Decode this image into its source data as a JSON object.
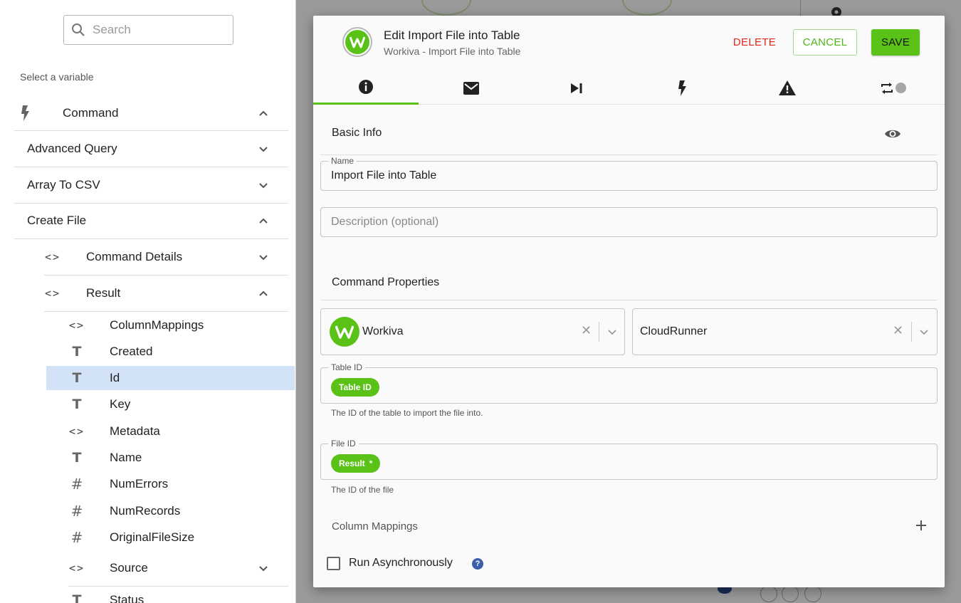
{
  "left_panel": {
    "search_placeholder": "Search",
    "select_label": "Select a variable",
    "items": [
      {
        "label": "Command",
        "icon": "lightning-icon",
        "expanded": true
      },
      {
        "label": "Advanced Query",
        "expanded": false
      },
      {
        "label": "Array To CSV",
        "expanded": false
      },
      {
        "label": "Create File",
        "expanded": true
      },
      {
        "label": "Command Details",
        "icon": "code-icon",
        "expanded": false
      },
      {
        "label": "Result",
        "icon": "code-icon",
        "expanded": true
      },
      {
        "label": "ColumnMappings",
        "icon": "code-icon"
      },
      {
        "label": "Created",
        "icon": "text-type-icon"
      },
      {
        "label": "Id",
        "icon": "text-type-icon",
        "selected": true
      },
      {
        "label": "Key",
        "icon": "text-type-icon"
      },
      {
        "label": "Metadata",
        "icon": "code-icon"
      },
      {
        "label": "Name",
        "icon": "text-type-icon"
      },
      {
        "label": "NumErrors",
        "icon": "number-type-icon"
      },
      {
        "label": "NumRecords",
        "icon": "number-type-icon"
      },
      {
        "label": "OriginalFileSize",
        "icon": "number-type-icon"
      },
      {
        "label": "Source",
        "icon": "code-icon",
        "expanded": false
      },
      {
        "label": "Status",
        "icon": "text-type-icon"
      }
    ]
  },
  "modal": {
    "title": "Edit Import File into Table",
    "subtitle": "Workiva - Import File into Table",
    "delete_label": "DELETE",
    "cancel_label": "CANCEL",
    "save_label": "SAVE",
    "tabs": [
      "info-icon",
      "mail-icon",
      "skip-next-icon",
      "lightning-icon",
      "warning-icon",
      "repeat-toggle-icon"
    ],
    "basic_info_heading": "Basic Info",
    "name_label": "Name",
    "name_value": "Import File into Table",
    "description_placeholder": "Description (optional)",
    "command_properties_heading": "Command Properties",
    "connector_value": "Workiva",
    "runner_value": "CloudRunner",
    "table_id_label": "Table ID",
    "table_id_chip": "Table ID",
    "table_id_help": "The ID of the table to import the file into.",
    "file_id_label": "File ID",
    "file_id_chip": "Result",
    "file_id_help": "The ID of the file",
    "column_mappings_label": "Column Mappings",
    "run_async_label": "Run Asynchronously",
    "help_symbol": "?"
  },
  "colors": {
    "accent_green": "#5ac216",
    "delete_red": "#e0261c",
    "selected_row": "#d3e3f7",
    "help_blue": "#3b5fa8"
  }
}
